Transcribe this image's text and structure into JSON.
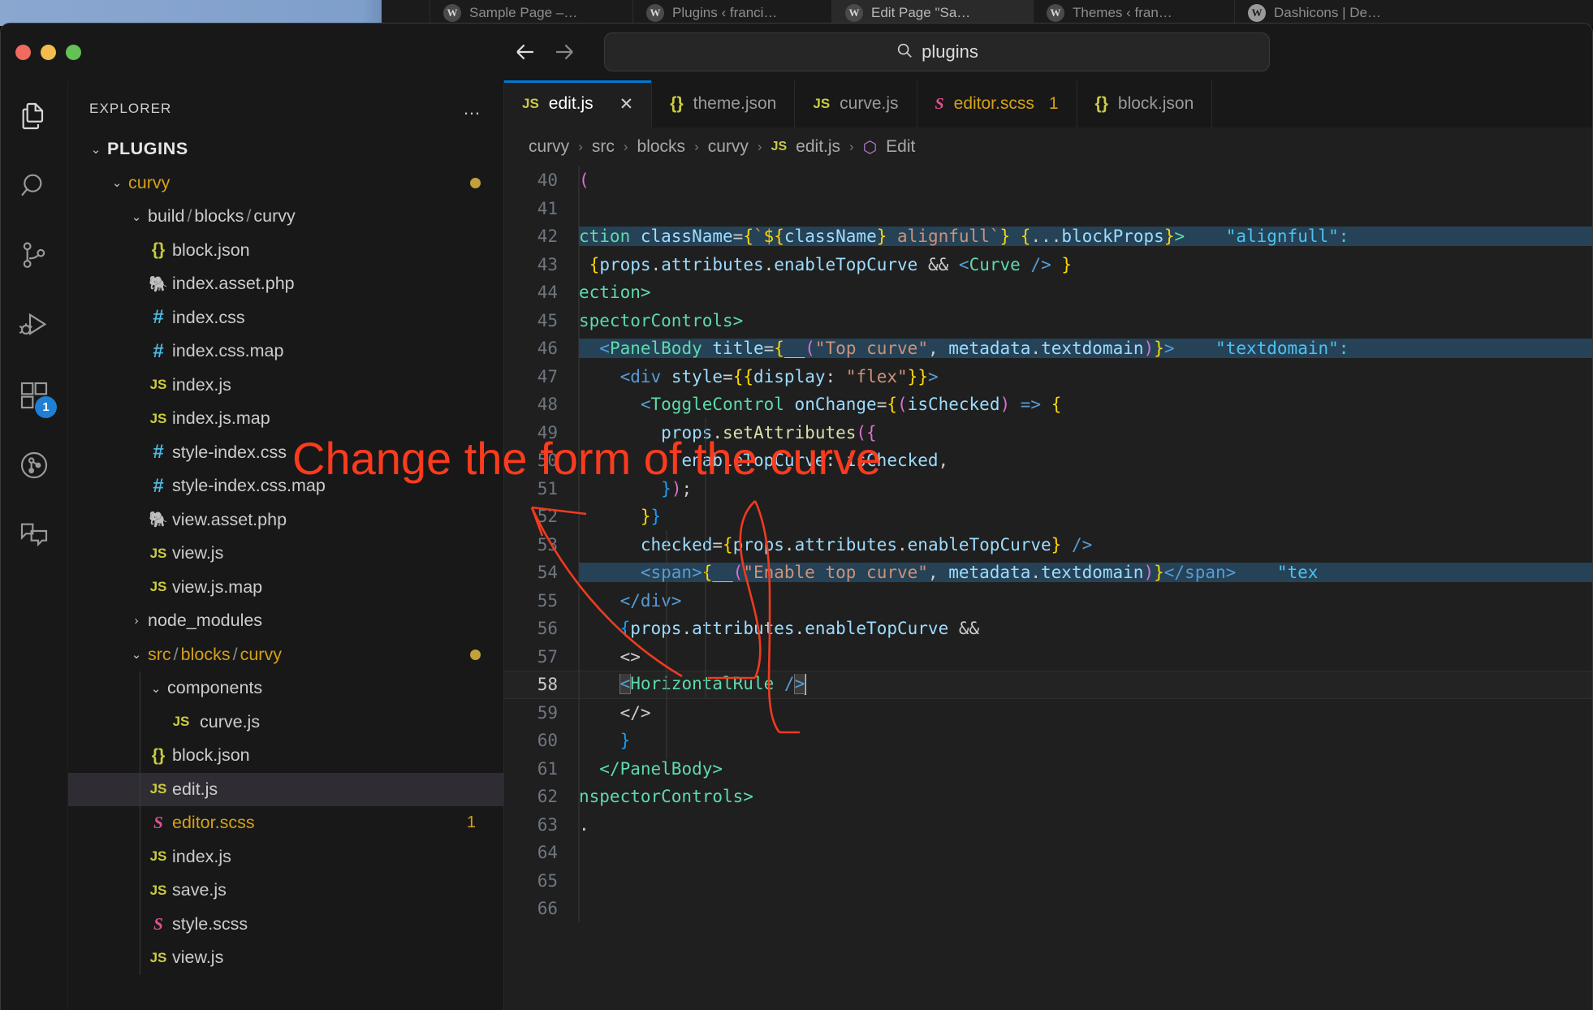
{
  "browser": {
    "tabs": [
      {
        "label": "",
        "icon": "",
        "active": false,
        "blank": true
      },
      {
        "label": "Sample Page –…",
        "icon": "wordpress-icon",
        "active": false
      },
      {
        "label": "Plugins ‹ franci…",
        "icon": "wordpress-icon",
        "active": false
      },
      {
        "label": "Edit Page \"Sa…",
        "icon": "wordpress-icon",
        "active": true
      },
      {
        "label": "Themes ‹ fran…",
        "icon": "wordpress-icon",
        "active": false
      },
      {
        "label": "Dashicons | De…",
        "icon": "wordpress-icon",
        "active": false
      }
    ]
  },
  "titlebar": {
    "back_icon": "arrow-left-icon",
    "forward_icon": "arrow-right-icon",
    "search": {
      "value": "plugins",
      "icon": "search-icon"
    }
  },
  "activitybar": {
    "items": [
      {
        "name": "explorer",
        "icon": "files-icon",
        "badge": null
      },
      {
        "name": "search",
        "icon": "search-icon",
        "badge": null
      },
      {
        "name": "source-control",
        "icon": "source-control-icon",
        "badge": null
      },
      {
        "name": "run-and-debug",
        "icon": "run-debug-icon",
        "badge": null
      },
      {
        "name": "extensions",
        "icon": "extensions-icon",
        "badge": "1"
      },
      {
        "name": "remote-explorer",
        "icon": "remote-icon",
        "badge": null
      },
      {
        "name": "chat",
        "icon": "chat-icon",
        "badge": null
      }
    ]
  },
  "sidebar": {
    "title": "EXPLORER",
    "more_actions": "…",
    "root": "PLUGINS",
    "items": [
      {
        "depth": 1,
        "chevron": "v",
        "label": "curvy",
        "kind": "folder-y",
        "dirty": true
      },
      {
        "depth": 2,
        "chevron": "v",
        "label": "build/blocks/curvy",
        "kind": "folder",
        "parts": [
          "build",
          "blocks",
          "curvy"
        ]
      },
      {
        "depth": 3,
        "chevron": "",
        "label": "block.json",
        "kind": "json"
      },
      {
        "depth": 3,
        "chevron": "",
        "label": "index.asset.php",
        "kind": "php"
      },
      {
        "depth": 3,
        "chevron": "",
        "label": "index.css",
        "kind": "css"
      },
      {
        "depth": 3,
        "chevron": "",
        "label": "index.css.map",
        "kind": "css"
      },
      {
        "depth": 3,
        "chevron": "",
        "label": "index.js",
        "kind": "js"
      },
      {
        "depth": 3,
        "chevron": "",
        "label": "index.js.map",
        "kind": "js"
      },
      {
        "depth": 3,
        "chevron": "",
        "label": "style-index.css",
        "kind": "css"
      },
      {
        "depth": 3,
        "chevron": "",
        "label": "style-index.css.map",
        "kind": "css"
      },
      {
        "depth": 3,
        "chevron": "",
        "label": "view.asset.php",
        "kind": "php"
      },
      {
        "depth": 3,
        "chevron": "",
        "label": "view.js",
        "kind": "js"
      },
      {
        "depth": 3,
        "chevron": "",
        "label": "view.js.map",
        "kind": "js"
      },
      {
        "depth": 2,
        "chevron": ">",
        "label": "node_modules",
        "kind": "folder"
      },
      {
        "depth": 2,
        "chevron": "v",
        "label": "src/blocks/curvy",
        "kind": "folder-y",
        "parts": [
          "src",
          "blocks",
          "curvy"
        ],
        "dirty": true
      },
      {
        "depth": 3,
        "chevron": "v",
        "label": "components",
        "kind": "folder"
      },
      {
        "depth": 4,
        "chevron": "",
        "label": "curve.js",
        "kind": "js"
      },
      {
        "depth": 3,
        "chevron": "",
        "label": "block.json",
        "kind": "json"
      },
      {
        "depth": 3,
        "chevron": "",
        "label": "edit.js",
        "kind": "js",
        "selected": true
      },
      {
        "depth": 3,
        "chevron": "",
        "label": "editor.scss",
        "kind": "scss",
        "problems": "1",
        "warn": true
      },
      {
        "depth": 3,
        "chevron": "",
        "label": "index.js",
        "kind": "js"
      },
      {
        "depth": 3,
        "chevron": "",
        "label": "save.js",
        "kind": "js"
      },
      {
        "depth": 3,
        "chevron": "",
        "label": "style.scss",
        "kind": "scss"
      },
      {
        "depth": 3,
        "chevron": "",
        "label": "view.js",
        "kind": "js"
      }
    ]
  },
  "editor": {
    "tabs": [
      {
        "label": "edit.js",
        "kind": "js",
        "active": true,
        "close": "✕"
      },
      {
        "label": "theme.json",
        "kind": "json",
        "active": false
      },
      {
        "label": "curve.js",
        "kind": "js",
        "active": false
      },
      {
        "label": "editor.scss",
        "kind": "scss",
        "active": false,
        "problems": "1"
      },
      {
        "label": "block.json",
        "kind": "json",
        "active": false
      }
    ],
    "breadcrumb": [
      "curvy",
      "src",
      "blocks",
      "curvy",
      "edit.js",
      "Edit"
    ],
    "breadcrumb_sep": "›",
    "breadcrumb_file_icon": "js-icon",
    "breadcrumb_symbol_icon": "symbol-class-icon",
    "lines": [
      {
        "n": "40"
      },
      {
        "n": "41"
      },
      {
        "n": "42"
      },
      {
        "n": "43"
      },
      {
        "n": "44"
      },
      {
        "n": "45"
      },
      {
        "n": "46"
      },
      {
        "n": "47"
      },
      {
        "n": "48"
      },
      {
        "n": "49"
      },
      {
        "n": "50"
      },
      {
        "n": "51"
      },
      {
        "n": "52"
      },
      {
        "n": "53"
      },
      {
        "n": "54"
      },
      {
        "n": "55"
      },
      {
        "n": "56"
      },
      {
        "n": "57"
      },
      {
        "n": "58"
      },
      {
        "n": "59"
      },
      {
        "n": "60"
      },
      {
        "n": "61"
      },
      {
        "n": "62"
      },
      {
        "n": "63"
      },
      {
        "n": "64"
      },
      {
        "n": "65"
      },
      {
        "n": "66"
      }
    ],
    "code_text": {
      "l40": "(",
      "l41": "",
      "l42": "ction className={`${className} alignfull`} {...blockProps}>",
      "l42_inlay": "\"alignfull\":",
      "l43": "{props.attributes.enableTopCurve && <Curve /> }",
      "l44": "ection>",
      "l45": "spectorControls>",
      "l46": "<PanelBody title={__(\"Top curve\", metadata.textdomain)}>",
      "l46_inlay": "\"textdomain\":",
      "l47": "<div style={{display: \"flex\"}}>",
      "l48": "<ToggleControl onChange={(isChecked) => {",
      "l49": "props.setAttributes({",
      "l50": "enableTopCurve: isChecked,",
      "l51": "});",
      "l52": "}}",
      "l53": "checked={props.attributes.enableTopCurve} />",
      "l54": "<span>{__(\"Enable top curve\", metadata.textdomain)}</span>",
      "l54_inlay": "\"tex",
      "l55": "</div>",
      "l56": "{props.attributes.enableTopCurve &&",
      "l57": "<>",
      "l58": "<HorizontalRule />",
      "l59": "</>",
      "l60": "}",
      "l61": "</PanelBody>",
      "l62": "nspectorControls>",
      "l63": "",
      "l64": "",
      "l65": "",
      "l66": ""
    },
    "active_line": "58"
  },
  "annotation": {
    "text": "Change the form of the curve",
    "color": "#fb3b1e",
    "arrow": "curved-arrow-to-line-58"
  }
}
